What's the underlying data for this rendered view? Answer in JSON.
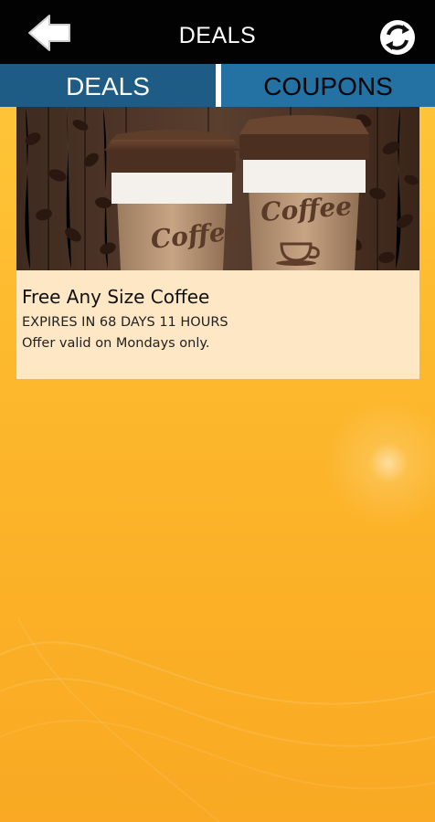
{
  "header": {
    "title": "DEALS",
    "back_icon": "back-arrow-icon",
    "refresh_icon": "refresh-icon"
  },
  "tabs": [
    {
      "label": "DEALS",
      "selected": true
    },
    {
      "label": "COUPONS",
      "selected": false
    }
  ],
  "deals": [
    {
      "image": {
        "cup_label_left": "Coffee",
        "cup_label_right": "Coffee"
      },
      "title": "Free Any Size Coffee",
      "expires": "EXPIRES IN 68 DAYS 11 HOURS",
      "description": "Offer valid on Mondays only."
    }
  ],
  "colors": {
    "topbar": "#020202",
    "tab_bar": "#1e5b85",
    "background": "#fbb126",
    "card": "#fde7c4"
  }
}
